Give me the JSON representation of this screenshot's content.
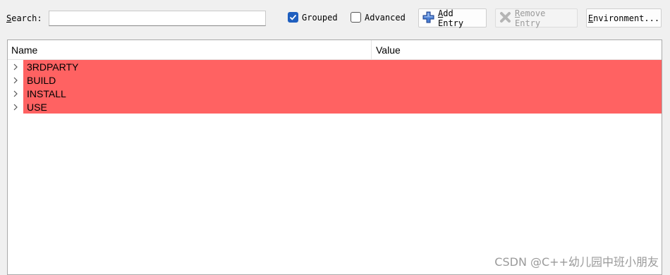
{
  "toolbar": {
    "search_label": "Search:",
    "search_value": "",
    "search_placeholder": "",
    "grouped": {
      "label": "Grouped",
      "checked": true
    },
    "advanced": {
      "label": "Advanced",
      "checked": false
    },
    "add_entry": {
      "label": "Add Entry",
      "icon": "plus-icon",
      "enabled": true
    },
    "remove_entry": {
      "label": "Remove Entry",
      "icon": "x-icon",
      "enabled": false
    },
    "environment": {
      "label": "Environment..."
    }
  },
  "tree": {
    "columns": [
      "Name",
      "Value"
    ],
    "rows": [
      {
        "name": "3RDPARTY",
        "value": ""
      },
      {
        "name": "BUILD",
        "value": ""
      },
      {
        "name": "INSTALL",
        "value": ""
      },
      {
        "name": "USE",
        "value": ""
      }
    ],
    "highlight_color": "#ff6262"
  },
  "watermark": "CSDN @C++幼儿园中班小朋友",
  "colors": {
    "accent": "#1f5fbf",
    "background": "#f0f0f0"
  }
}
